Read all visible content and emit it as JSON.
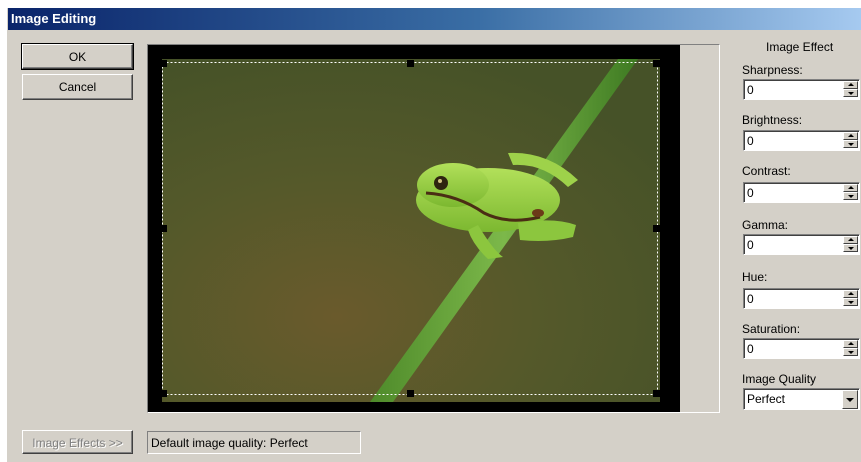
{
  "window": {
    "title": "Image Editing"
  },
  "buttons": {
    "ok": "OK",
    "cancel": "Cancel",
    "image_effects": "Image Effects >>"
  },
  "status": {
    "text": "Default image quality: Perfect"
  },
  "effects": {
    "heading": "Image Effect",
    "fields": [
      {
        "label": "Sharpness:",
        "value": "0"
      },
      {
        "label": "Brightness:",
        "value": "0"
      },
      {
        "label": "Contrast:",
        "value": "0"
      },
      {
        "label": "Gamma:",
        "value": "0"
      },
      {
        "label": "Hue:",
        "value": "0"
      },
      {
        "label": "Saturation:",
        "value": "0"
      }
    ],
    "quality_label": "Image Quality",
    "quality_value": "Perfect"
  },
  "colors": {
    "title_active": "#0a246a",
    "face": "#d4d0c8",
    "photo_bg": "#4f5a2a",
    "frog": "#8ac43a"
  }
}
